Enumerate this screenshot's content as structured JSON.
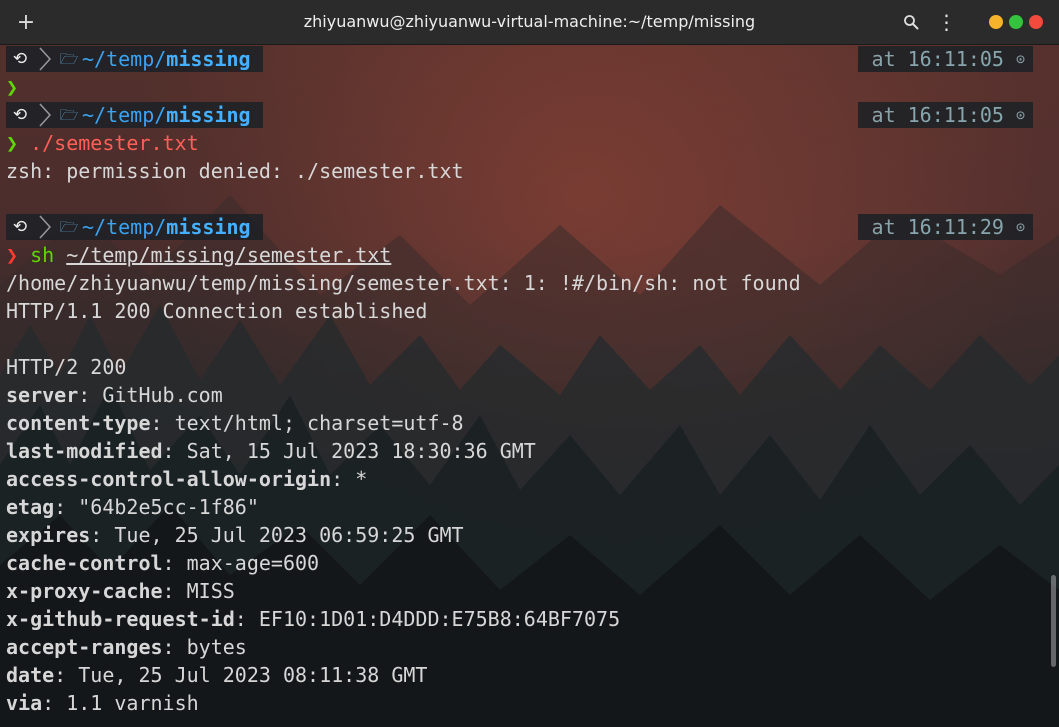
{
  "window": {
    "title": "zhiyuanwu@zhiyuanwu-virtual-machine:~/temp/missing",
    "new_tab_glyph": "+",
    "menu_glyph": "⋮",
    "controls": [
      "minimize",
      "maximize",
      "close"
    ],
    "colors": {
      "minimize": "#f5b32c",
      "maximize": "#35c33f",
      "close": "#f24a3d"
    }
  },
  "prompt": {
    "path_prefix": "~/temp/",
    "path_dir": "missing",
    "at_label": "at"
  },
  "session": [
    {
      "type": "prompt",
      "time": "16:11:05"
    },
    {
      "type": "status",
      "arrow": "❯"
    },
    {
      "type": "prompt",
      "time": "16:11:05"
    },
    {
      "type": "cmd",
      "arrow": "❯",
      "text": "./semester.txt"
    },
    {
      "type": "output",
      "text": "zsh: permission denied: ./semester.txt"
    },
    {
      "type": "blank"
    },
    {
      "type": "prompt",
      "time": "16:11:29"
    },
    {
      "type": "cmd2",
      "arrow": "❯",
      "prog": "sh",
      "arg": "~/temp/missing/semester.txt"
    },
    {
      "type": "output",
      "text": "/home/zhiyuanwu/temp/missing/semester.txt: 1: !#/bin/sh: not found"
    },
    {
      "type": "output",
      "text": "HTTP/1.1 200 Connection established"
    },
    {
      "type": "blank"
    },
    {
      "type": "output",
      "text": "HTTP/2 200"
    },
    {
      "type": "header",
      "key": "server",
      "value": "GitHub.com"
    },
    {
      "type": "header",
      "key": "content-type",
      "value": "text/html; charset=utf-8"
    },
    {
      "type": "header",
      "key": "last-modified",
      "value": "Sat, 15 Jul 2023 18:30:36 GMT"
    },
    {
      "type": "header",
      "key": "access-control-allow-origin",
      "value": "*"
    },
    {
      "type": "header",
      "key": "etag",
      "value": "\"64b2e5cc-1f86\""
    },
    {
      "type": "header",
      "key": "expires",
      "value": "Tue, 25 Jul 2023 06:59:25 GMT"
    },
    {
      "type": "header",
      "key": "cache-control",
      "value": "max-age=600"
    },
    {
      "type": "header",
      "key": "x-proxy-cache",
      "value": "MISS"
    },
    {
      "type": "header",
      "key": "x-github-request-id",
      "value": "EF10:1D01:D4DDD:E75B8:64BF7075"
    },
    {
      "type": "header",
      "key": "accept-ranges",
      "value": "bytes"
    },
    {
      "type": "header",
      "key": "date",
      "value": "Tue, 25 Jul 2023 08:11:38 GMT"
    },
    {
      "type": "header",
      "key": "via",
      "value": "1.1 varnish"
    }
  ]
}
